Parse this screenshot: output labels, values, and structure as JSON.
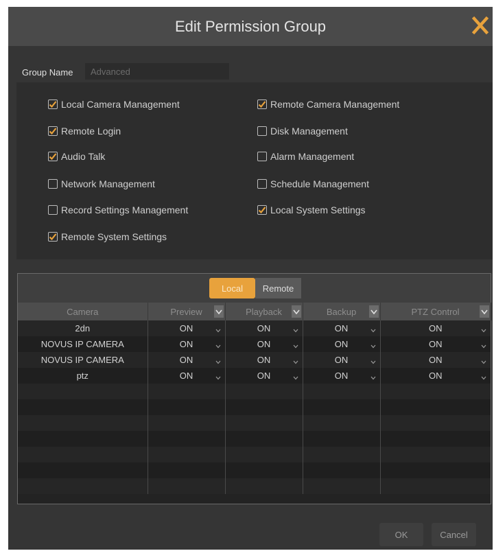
{
  "dialog": {
    "title": "Edit Permission Group",
    "group_name_label": "Group Name",
    "group_name_value": "Advanced"
  },
  "permissions": [
    {
      "label": "Local Camera Management",
      "checked": true
    },
    {
      "label": "Remote Camera Management",
      "checked": true
    },
    {
      "label": "Remote Login",
      "checked": true
    },
    {
      "label": "Disk Management",
      "checked": false
    },
    {
      "label": "Audio Talk",
      "checked": true
    },
    {
      "label": "Alarm Management",
      "checked": false
    },
    {
      "label": "Network Management",
      "checked": false
    },
    {
      "label": "Schedule Management",
      "checked": false
    },
    {
      "label": "Record Settings Management",
      "checked": false
    },
    {
      "label": "Local System Settings",
      "checked": true
    },
    {
      "label": "Remote System Settings",
      "checked": true
    }
  ],
  "tabs": {
    "local": "Local",
    "remote": "Remote",
    "active": "local"
  },
  "table": {
    "headers": [
      "Camera",
      "Preview",
      "Playback",
      "Backup",
      "PTZ Control"
    ],
    "rows": [
      {
        "camera": "2dn",
        "preview": "ON",
        "playback": "ON",
        "backup": "ON",
        "ptz": "ON"
      },
      {
        "camera": "NOVUS IP CAMERA",
        "preview": "ON",
        "playback": "ON",
        "backup": "ON",
        "ptz": "ON"
      },
      {
        "camera": "NOVUS IP CAMERA",
        "preview": "ON",
        "playback": "ON",
        "backup": "ON",
        "ptz": "ON"
      },
      {
        "camera": "ptz",
        "preview": "ON",
        "playback": "ON",
        "backup": "ON",
        "ptz": "ON"
      }
    ]
  },
  "buttons": {
    "ok": "OK",
    "cancel": "Cancel"
  },
  "colors": {
    "accent": "#e8a23c",
    "background": "#353535"
  }
}
